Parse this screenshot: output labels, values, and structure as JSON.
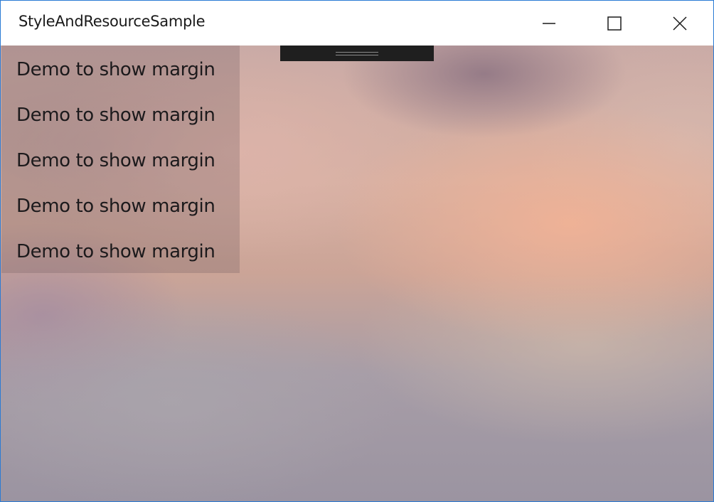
{
  "window": {
    "title": "StyleAndResourceSample"
  },
  "caption_buttons": {
    "minimize_icon": "minimize-icon",
    "maximize_icon": "maximize-icon",
    "close_icon": "close-icon"
  },
  "content": {
    "items": [
      {
        "label": "Demo to show margin"
      },
      {
        "label": "Demo to show margin"
      },
      {
        "label": "Demo to show margin"
      },
      {
        "label": "Demo to show margin"
      },
      {
        "label": "Demo to show margin"
      }
    ]
  },
  "colors": {
    "window_border": "#2b7bd4",
    "titlebar_background": "#ffffff",
    "debug_toolbar": "#1f1f1f",
    "text": "#1c1a1c"
  }
}
